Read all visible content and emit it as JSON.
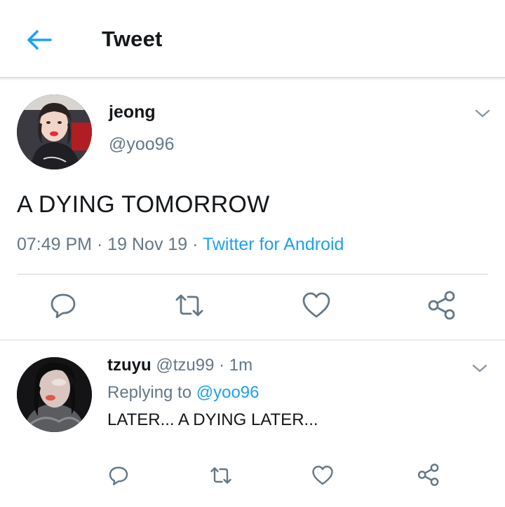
{
  "header": {
    "title": "Tweet",
    "back_icon": "arrow-left-icon"
  },
  "colors": {
    "accent": "#1da1f2",
    "text_primary": "#14171a",
    "text_secondary": "#657786",
    "divider": "#ccd6dd"
  },
  "main_tweet": {
    "display_name": "jeong",
    "handle": "@yoo96",
    "text": "A DYING TOMORROW",
    "time": "07:49 PM",
    "date": "19 Nov 19",
    "separator": " · ",
    "source": "Twitter for Android",
    "actions": [
      {
        "name": "reply",
        "icon": "comment-icon"
      },
      {
        "name": "retweet",
        "icon": "retweet-icon"
      },
      {
        "name": "like",
        "icon": "heart-icon"
      },
      {
        "name": "share",
        "icon": "share-icon"
      }
    ]
  },
  "reply_tweet": {
    "display_name": "tzuyu",
    "handle": "@tzu99",
    "time_ago": "1m",
    "separator": " · ",
    "replying_label": "Replying to",
    "replying_to": "@yoo96",
    "text": "LATER... A DYING LATER...",
    "actions": [
      {
        "name": "reply",
        "icon": "comment-icon"
      },
      {
        "name": "retweet",
        "icon": "retweet-icon"
      },
      {
        "name": "like",
        "icon": "heart-icon"
      },
      {
        "name": "share",
        "icon": "share-icon"
      }
    ]
  }
}
